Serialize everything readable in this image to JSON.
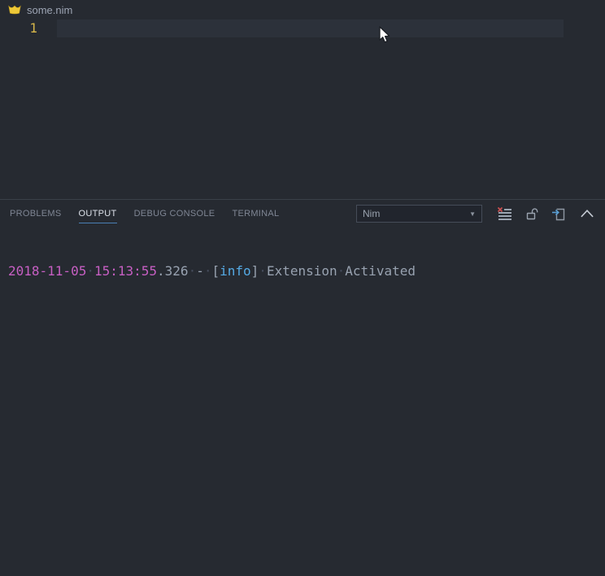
{
  "editor": {
    "tab": {
      "filename": "some.nim"
    },
    "active_line_number": "1",
    "line_content": ""
  },
  "panel": {
    "tabs": [
      {
        "label": "PROBLEMS",
        "active": false
      },
      {
        "label": "OUTPUT",
        "active": true
      },
      {
        "label": "DEBUG CONSOLE",
        "active": false
      },
      {
        "label": "TERMINAL",
        "active": false
      }
    ],
    "channel_select": {
      "value": "Nim"
    },
    "output": {
      "plain_text": "2018-11-05 15:13:55.326 - [info] Extension Activated",
      "segments": [
        {
          "text": "2018-11-05",
          "color": "magenta"
        },
        {
          "text": "·",
          "color": "whitespace-dot"
        },
        {
          "text": "15:13:55",
          "color": "magenta"
        },
        {
          "text": ".326",
          "color": "gray"
        },
        {
          "text": "·",
          "color": "whitespace-dot"
        },
        {
          "text": "-",
          "color": "gray"
        },
        {
          "text": "·",
          "color": "whitespace-dot"
        },
        {
          "text": "[",
          "color": "gray"
        },
        {
          "text": "info",
          "color": "blue"
        },
        {
          "text": "]",
          "color": "gray"
        },
        {
          "text": "·",
          "color": "whitespace-dot"
        },
        {
          "text": "Extension",
          "color": "gray"
        },
        {
          "text": "·",
          "color": "whitespace-dot"
        },
        {
          "text": "Activated",
          "color": "gray"
        }
      ]
    }
  },
  "icons": {
    "file_tab": "nim-crown-icon",
    "dropdown_arrow": "chevron-down-icon",
    "actions": [
      "clear-output-icon",
      "unlock-icon",
      "open-log-file-icon",
      "chevron-up-icon"
    ]
  },
  "colors": {
    "background": "#262a31",
    "current_line_highlight": "#2c313a",
    "line_number_active": "#d7b74a",
    "panel_tab_active_underline": "#4a7fb5",
    "log_timestamp": "#c75fc3",
    "log_info_level": "#55aae4",
    "log_text": "#98a2b0",
    "clear_icon_x": "#d25252"
  }
}
